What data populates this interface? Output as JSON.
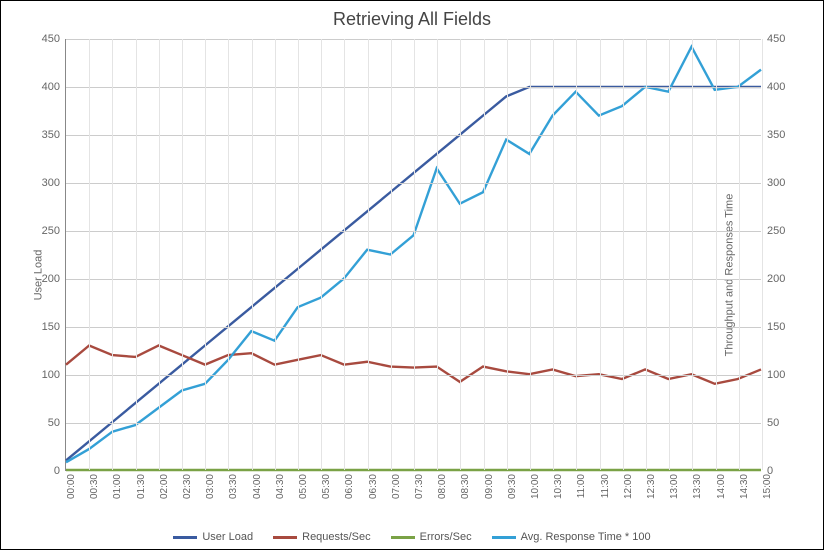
{
  "chart_data": {
    "type": "line",
    "title": "Retrieving All Fields",
    "xlabel": "",
    "ylabel_left": "User Load",
    "ylabel_right": "Throughput and Responses Time",
    "y_left": {
      "min": 0,
      "max": 450,
      "step": 50
    },
    "y_right": {
      "min": 0,
      "max": 450,
      "step": 50
    },
    "categories": [
      "00:00",
      "00:30",
      "01:00",
      "01:30",
      "02:00",
      "02:30",
      "03:00",
      "03:30",
      "04:00",
      "04:30",
      "05:00",
      "05:30",
      "06:00",
      "06:30",
      "07:00",
      "07:30",
      "08:00",
      "08:30",
      "09:00",
      "09:30",
      "10:00",
      "10:30",
      "11:00",
      "11:30",
      "12:00",
      "12:30",
      "13:00",
      "13:30",
      "14:00",
      "14:30",
      "15:00"
    ],
    "series": [
      {
        "name": "User Load",
        "axis": "left",
        "color": "#3a5ba0",
        "values": [
          10,
          30,
          50,
          70,
          90,
          110,
          130,
          150,
          170,
          190,
          210,
          230,
          250,
          270,
          290,
          310,
          330,
          350,
          370,
          390,
          400,
          400,
          400,
          400,
          400,
          400,
          400,
          400,
          400,
          400,
          400
        ]
      },
      {
        "name": "Requests/Sec",
        "axis": "right",
        "color": "#a84a3f",
        "values": [
          110,
          130,
          120,
          118,
          130,
          120,
          110,
          120,
          122,
          110,
          115,
          120,
          110,
          113,
          108,
          107,
          108,
          92,
          108,
          103,
          100,
          105,
          98,
          100,
          95,
          105,
          95,
          100,
          90,
          95,
          105
        ]
      },
      {
        "name": "Errors/Sec",
        "axis": "right",
        "color": "#7aa246",
        "values": [
          0,
          0,
          0,
          0,
          0,
          0,
          0,
          0,
          0,
          0,
          0,
          0,
          0,
          0,
          0,
          0,
          0,
          0,
          0,
          0,
          0,
          0,
          0,
          0,
          0,
          0,
          0,
          0,
          0,
          0,
          0
        ]
      },
      {
        "name": "Avg. Response Time * 100",
        "axis": "right",
        "color": "#33a0d6",
        "values": [
          8,
          22,
          40,
          47,
          65,
          83,
          90,
          115,
          145,
          135,
          170,
          180,
          200,
          230,
          225,
          245,
          315,
          278,
          290,
          345,
          330,
          370,
          395,
          370,
          380,
          400,
          395,
          442,
          397,
          400,
          418
        ]
      }
    ],
    "legend_position": "bottom"
  },
  "legend": {
    "items": [
      {
        "label": "User Load",
        "color": "#3a5ba0"
      },
      {
        "label": "Requests/Sec",
        "color": "#a84a3f"
      },
      {
        "label": "Errors/Sec",
        "color": "#7aa246"
      },
      {
        "label": "Avg. Response Time * 100",
        "color": "#33a0d6"
      }
    ]
  }
}
